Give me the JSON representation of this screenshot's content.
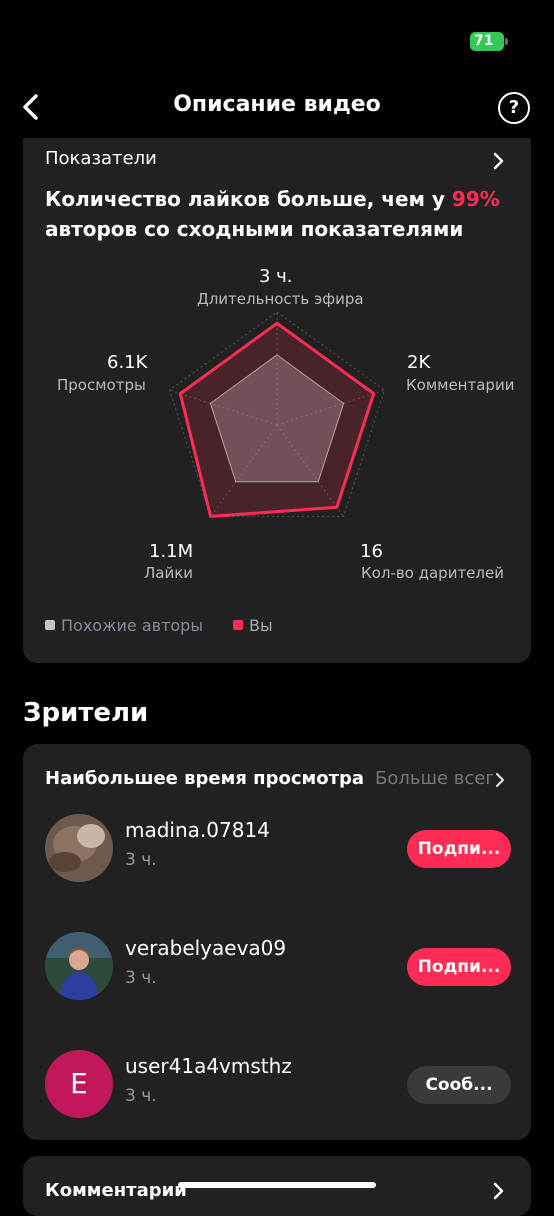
{
  "status_bar": {
    "battery": "71"
  },
  "nav": {
    "back_icon": "chevron-left-icon",
    "title": "Описание видео",
    "help_icon": "question-icon"
  },
  "metrics": {
    "header": "Показатели",
    "headline_pre": "Количество лайков больше, чем у ",
    "headline_accent": "99%",
    "headline_post": " авторов со сходными показателями",
    "radar": {
      "axes": [
        {
          "label": "Длительность эфира",
          "value": "3 ч."
        },
        {
          "label": "Комментарии",
          "value": "2K"
        },
        {
          "label": "Кол-во дарителей",
          "value": "16"
        },
        {
          "label": "Лайки",
          "value": "1.1M"
        },
        {
          "label": "Просмотры",
          "value": "6.1K"
        }
      ],
      "series": [
        {
          "name": "Похожие авторы",
          "levels": [
            0.62,
            0.62,
            0.62,
            0.62,
            0.62
          ],
          "color": "#b0a3a6"
        },
        {
          "name": "Вы",
          "levels": [
            0.9,
            0.9,
            0.9,
            1.0,
            0.9
          ],
          "color": "#fe2c55"
        }
      ]
    },
    "legend": [
      {
        "label": "Похожие авторы",
        "color": "#c4c4c4"
      },
      {
        "label": "Вы",
        "color": "#fe2c55"
      }
    ]
  },
  "viewers": {
    "section_title": "Зрители",
    "card_title": "Наибольшее время просмотра",
    "more_label": "Больше всего",
    "users": [
      {
        "name": "madina.07814",
        "time": "3 ч.",
        "button": "Подпи..."
      },
      {
        "name": "verabelyaeva09",
        "time": "3 ч.",
        "button": "Подпи..."
      },
      {
        "name": "user41a4vmsthz",
        "time": "3 ч.",
        "button": "Сооб...",
        "initial": "E"
      }
    ]
  },
  "comments": {
    "title": "Комментарии"
  }
}
